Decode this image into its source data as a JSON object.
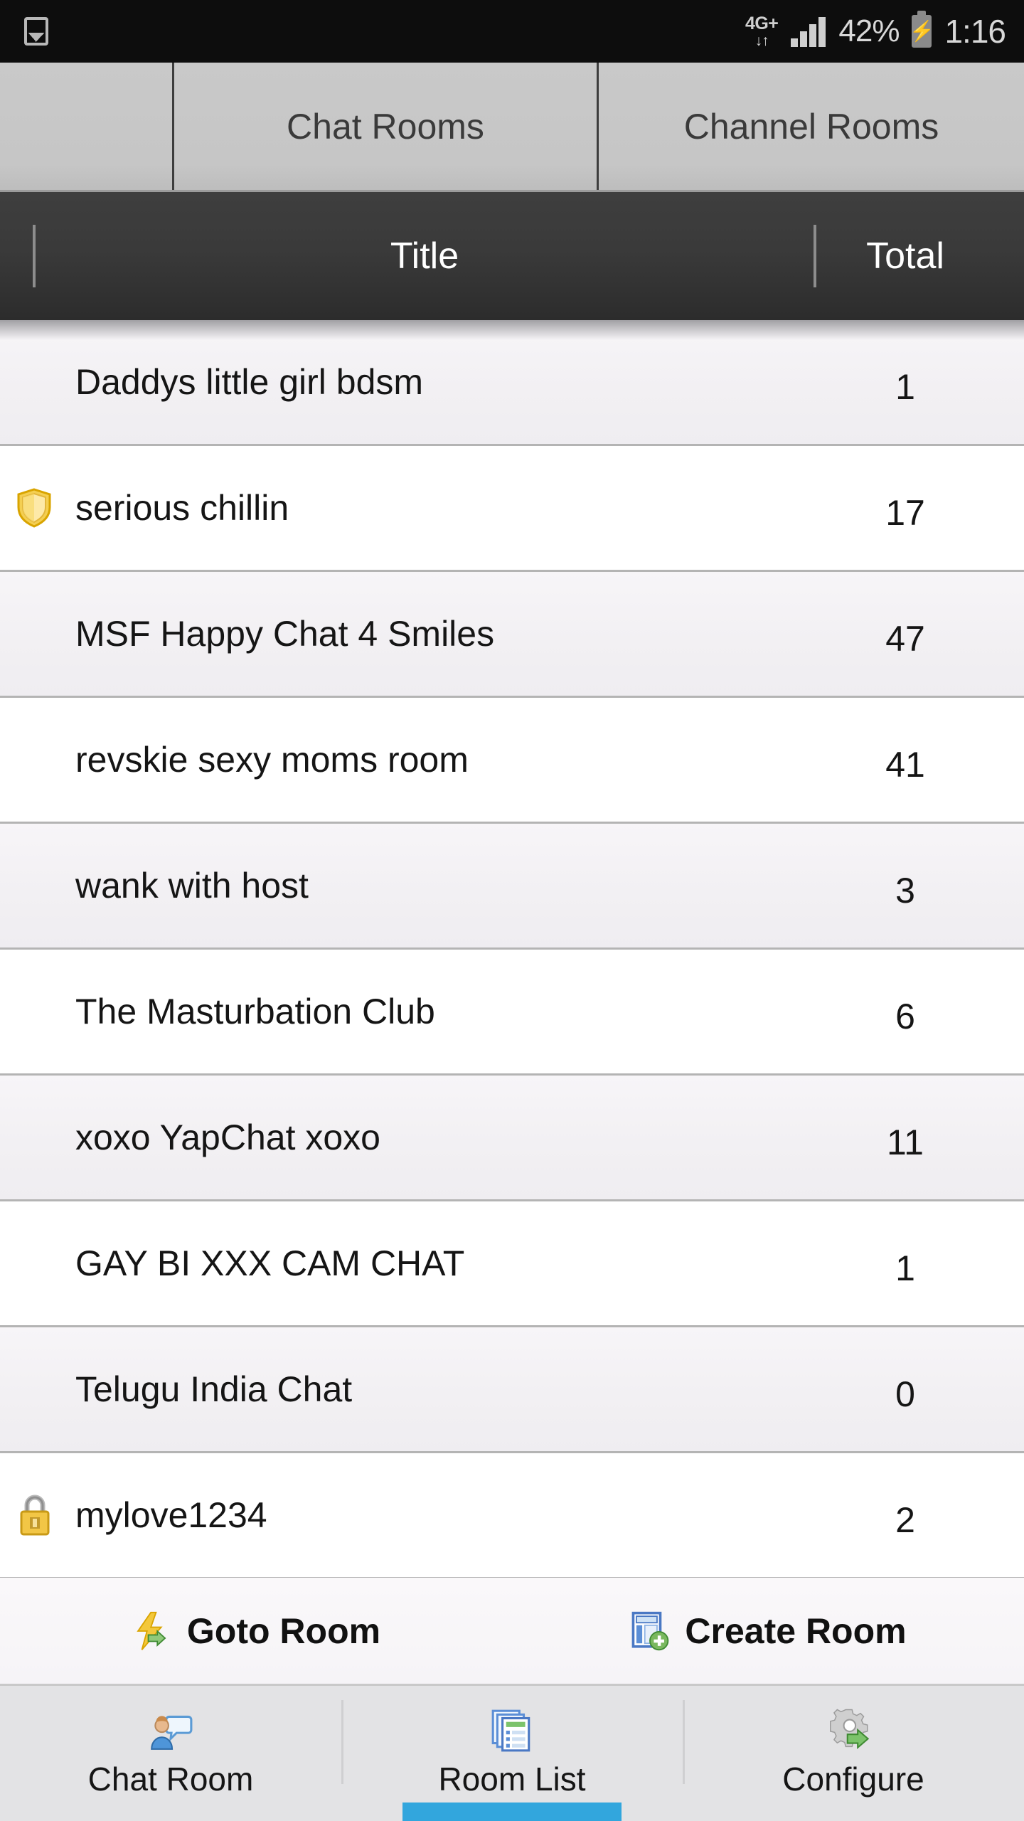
{
  "status_bar": {
    "gallery_icon": "gallery-icon",
    "network_type": "4G+",
    "network_arrows": "↓↑",
    "signal_icon": "signal-bars-icon",
    "battery_percent": "42%",
    "battery_icon": "battery-charging-icon",
    "clock": "1:16"
  },
  "tabs": {
    "spacer_label": "",
    "items": [
      {
        "label": "Chat Rooms",
        "selected": true
      },
      {
        "label": "Channel Rooms",
        "selected": false
      }
    ]
  },
  "table": {
    "headers": {
      "title": "Title",
      "total": "Total"
    },
    "rows": [
      {
        "icon": "",
        "title": "Daddys little girl bdsm",
        "total": "1"
      },
      {
        "icon": "shield-icon",
        "title": "serious chillin",
        "total": "17"
      },
      {
        "icon": "",
        "title": "MSF Happy Chat 4 Smiles",
        "total": "47"
      },
      {
        "icon": "",
        "title": "revskie sexy moms room",
        "total": "41"
      },
      {
        "icon": "",
        "title": "wank with host",
        "total": "3"
      },
      {
        "icon": "",
        "title": "The Masturbation Club",
        "total": "6"
      },
      {
        "icon": "",
        "title": "xoxo YapChat xoxo",
        "total": "11"
      },
      {
        "icon": "",
        "title": "GAY BI XXX CAM CHAT",
        "total": "1"
      },
      {
        "icon": "",
        "title": "Telugu India Chat",
        "total": "0"
      },
      {
        "icon": "lock-icon",
        "title": "mylove1234",
        "total": "2"
      }
    ]
  },
  "action_bar": {
    "goto_room": {
      "label": "Goto Room",
      "icon": "lightning-arrow-icon"
    },
    "create_room": {
      "label": "Create Room",
      "icon": "new-window-plus-icon"
    }
  },
  "bottom_nav": {
    "items": [
      {
        "label": "Chat Room",
        "icon": "person-speech-bubble-icon",
        "active": false
      },
      {
        "label": "Room List",
        "icon": "stacked-documents-icon",
        "active": true
      },
      {
        "label": "Configure",
        "icon": "gear-arrow-icon",
        "active": false
      }
    ],
    "active_color": "#32a6dd"
  }
}
